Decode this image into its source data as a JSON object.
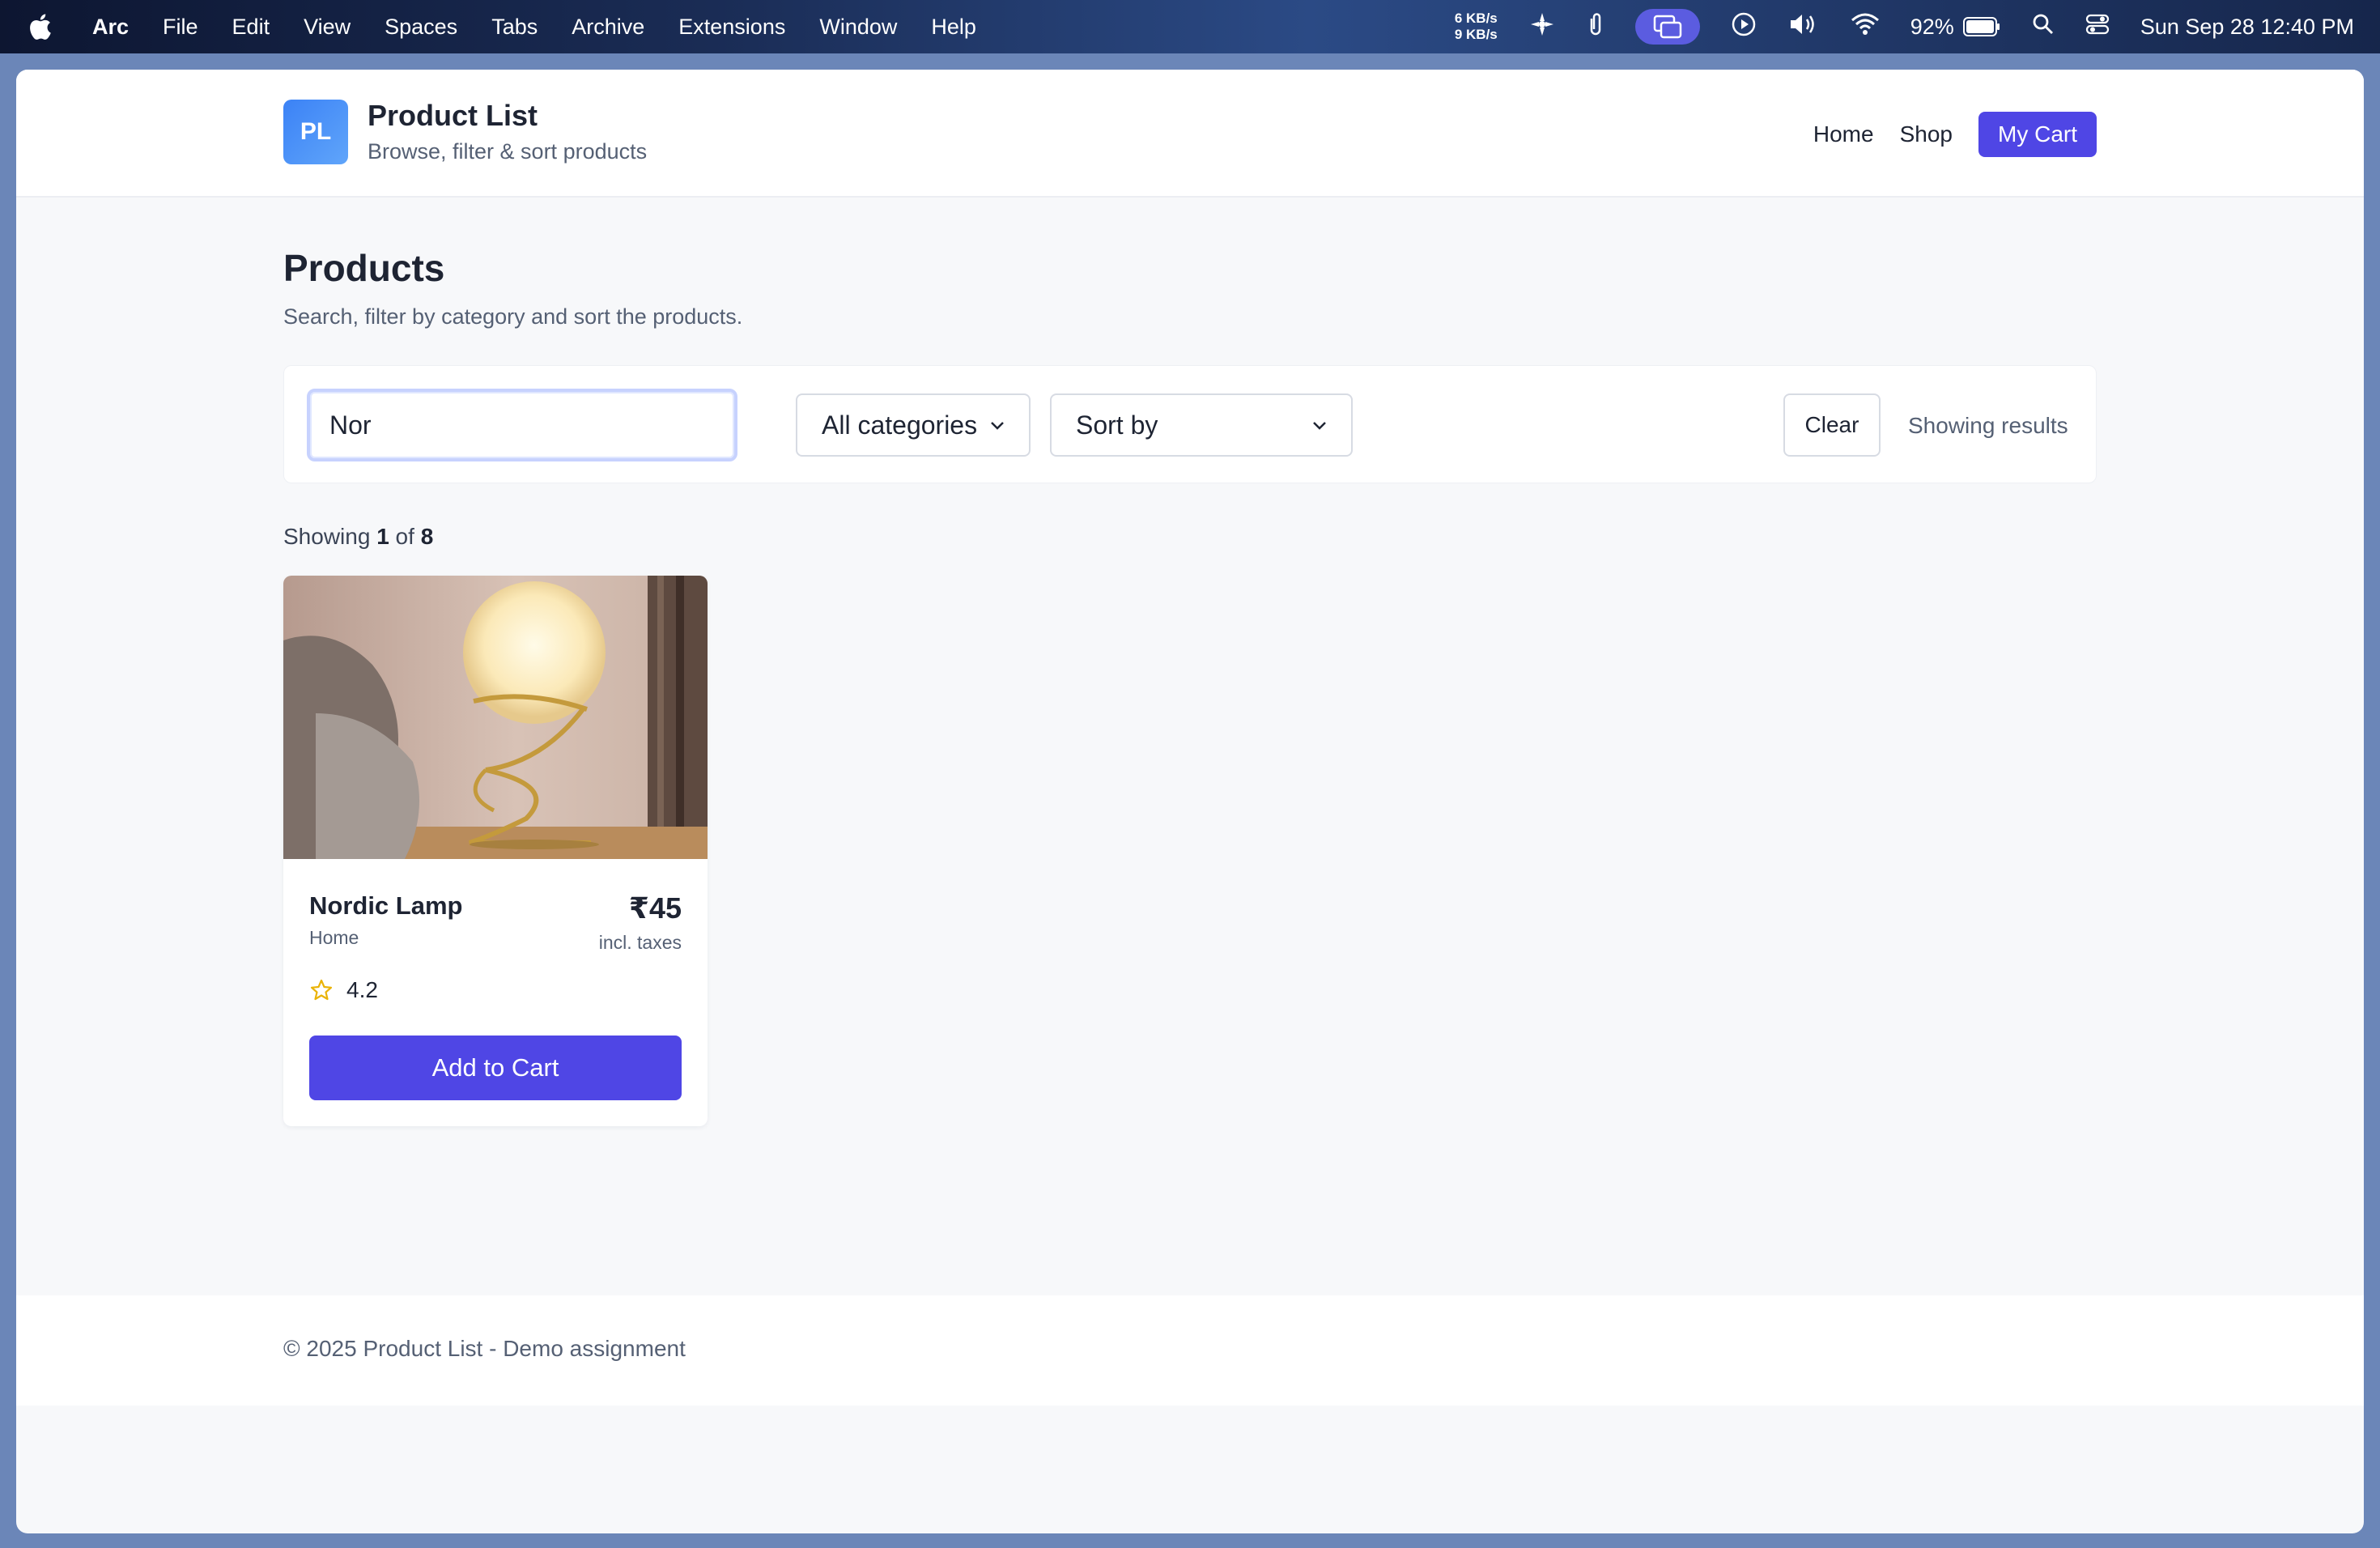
{
  "menubar": {
    "items": [
      "Arc",
      "File",
      "Edit",
      "View",
      "Spaces",
      "Tabs",
      "Archive",
      "Extensions",
      "Window",
      "Help"
    ],
    "net_up": "6 KB/s",
    "net_down": "9 KB/s",
    "battery": "92%",
    "datetime": "Sun Sep 28  12:40 PM"
  },
  "header": {
    "logo_text": "PL",
    "title": "Product List",
    "subtitle": "Browse, filter & sort products",
    "nav": {
      "home": "Home",
      "shop": "Shop",
      "cart": "My Cart"
    }
  },
  "main": {
    "title": "Products",
    "subtitle": "Search, filter by category and sort the products.",
    "filters": {
      "search_value": "Nor",
      "category_selected": "All categories",
      "sort_selected": "Sort by",
      "clear_label": "Clear",
      "status": "Showing results"
    },
    "count": {
      "prefix": "Showing",
      "shown": "1",
      "of": "of",
      "total": "8"
    },
    "products": [
      {
        "name": "Nordic Lamp",
        "category": "Home",
        "price": "₹45",
        "tax_note": "incl. taxes",
        "rating": "4.2",
        "button": "Add to Cart"
      }
    ]
  },
  "footer": {
    "text": "© 2025 Product List - Demo assignment"
  },
  "colors": {
    "accent": "#4f46e5",
    "logo": "#3b82f6",
    "star": "#eab308"
  }
}
